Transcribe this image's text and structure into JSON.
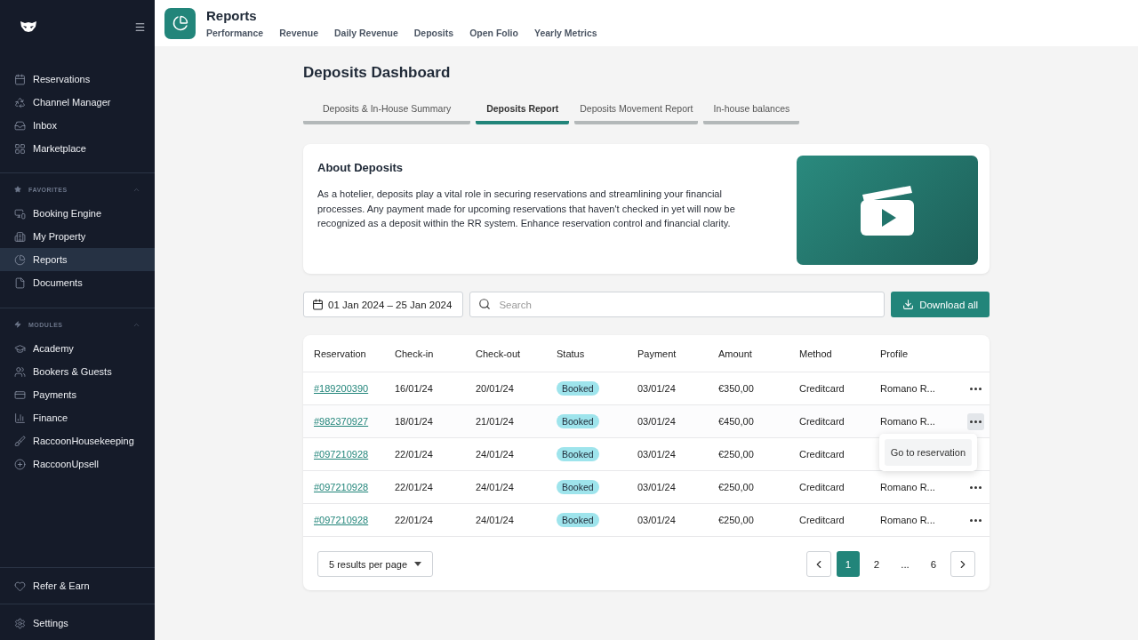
{
  "sidebar": {
    "main_items": [
      {
        "label": "Reservations",
        "selected": false
      },
      {
        "label": "Channel Manager",
        "selected": false
      },
      {
        "label": "Inbox",
        "selected": false
      },
      {
        "label": "Marketplace",
        "selected": false
      }
    ],
    "favorites": {
      "title": "FAVORITES",
      "expanded": true,
      "items": [
        {
          "label": "Booking Engine",
          "selected": false
        },
        {
          "label": "My Property",
          "selected": false
        },
        {
          "label": "Reports",
          "selected": true
        },
        {
          "label": "Documents",
          "selected": false
        }
      ]
    },
    "modules": {
      "title": "MODULES",
      "expanded": true,
      "items": [
        {
          "label": "Academy",
          "selected": false
        },
        {
          "label": "Bookers & Guests",
          "selected": false
        },
        {
          "label": "Payments",
          "selected": false
        },
        {
          "label": "Finance",
          "selected": false
        },
        {
          "label": "RaccoonHousekeeping",
          "selected": false
        },
        {
          "label": "RaccoonUpsell",
          "selected": false
        }
      ]
    },
    "footer_items": [
      {
        "label": "Refer & Earn"
      },
      {
        "label": "Settings"
      }
    ]
  },
  "header": {
    "title": "Reports",
    "nav": [
      "Performance",
      "Revenue",
      "Daily Revenue",
      "Deposits",
      "Open Folio",
      "Yearly Metrics"
    ]
  },
  "page_title": "Deposits Dashboard",
  "tabs": [
    {
      "label": "Deposits & In-House Summary",
      "selected": false
    },
    {
      "label": "Deposits Report",
      "selected": true
    },
    {
      "label": "Deposits Movement Report",
      "selected": false
    },
    {
      "label": "In-house balances",
      "selected": false
    }
  ],
  "about": {
    "title": "About Deposits",
    "text": "As a hotelier, deposits play a vital role in securing reservations and streamlining your financial processes. Any payment made for upcoming reservations that haven't checked in yet will now be recognized as a deposit within the RR system. Enhance reservation control and financial clarity."
  },
  "filters": {
    "date_range": "01 Jan 2024 – 25 Jan 2024",
    "search": {
      "placeholder": "Search"
    },
    "download_button": "Download all"
  },
  "table": {
    "columns": [
      "Reservation",
      "Check-in",
      "Check-out",
      "Status",
      "Payment",
      "Amount",
      "Method",
      "Profile"
    ],
    "rows": [
      {
        "reservation": "#189200390",
        "check_in": "16/01/24",
        "check_out": "20/01/24",
        "status": "Booked",
        "payment": "03/01/24",
        "amount": "€350,00",
        "method": "Creditcard",
        "profile": "Romano R...",
        "menu_open": false
      },
      {
        "reservation": "#982370927",
        "check_in": "18/01/24",
        "check_out": "21/01/24",
        "status": "Booked",
        "payment": "03/01/24",
        "amount": "€450,00",
        "method": "Creditcard",
        "profile": "Romano R...",
        "menu_open": true
      },
      {
        "reservation": "#097210928",
        "check_in": "22/01/24",
        "check_out": "24/01/24",
        "status": "Booked",
        "payment": "03/01/24",
        "amount": "€250,00",
        "method": "Creditcard",
        "menu_open": false
      },
      {
        "reservation": "#097210928",
        "check_in": "22/01/24",
        "check_out": "24/01/24",
        "status": "Booked",
        "payment": "03/01/24",
        "amount": "€250,00",
        "method": "Creditcard",
        "profile": "Romano R...",
        "menu_open": false
      },
      {
        "reservation": "#097210928",
        "check_in": "22/01/24",
        "check_out": "24/01/24",
        "status": "Booked",
        "payment": "03/01/24",
        "amount": "€250,00",
        "method": "Creditcard",
        "profile": "Romano R...",
        "menu_open": false
      }
    ],
    "row_menu": [
      "Go to reservation"
    ]
  },
  "footer": {
    "per_page": "5 results per page",
    "pages": [
      {
        "label": "1",
        "selected": true
      },
      {
        "label": "2",
        "selected": false
      },
      {
        "label": "...",
        "selected": false
      },
      {
        "label": "6",
        "selected": false
      }
    ]
  }
}
